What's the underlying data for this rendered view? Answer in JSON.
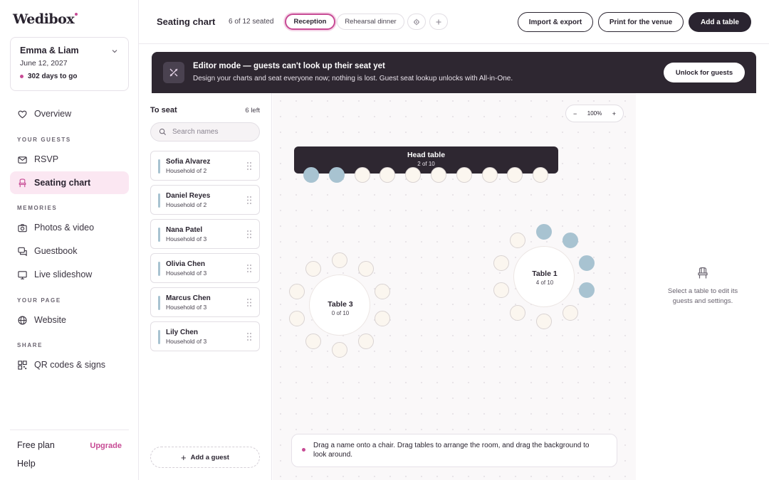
{
  "app": {
    "logo": "Wedibox"
  },
  "event": {
    "couple": "Emma & Liam",
    "date": "June 12, 2027",
    "countdown": "302 days to go"
  },
  "nav": {
    "overview": "Overview",
    "section_guests": "YOUR GUESTS",
    "rsvp": "RSVP",
    "seating_chart": "Seating chart",
    "section_memories": "MEMORIES",
    "photos_video": "Photos & video",
    "guestbook": "Guestbook",
    "live_slideshow": "Live slideshow",
    "section_page": "YOUR PAGE",
    "website": "Website",
    "section_share": "SHARE",
    "qr_codes": "QR codes & signs"
  },
  "footer": {
    "plan": "Free plan",
    "upgrade": "Upgrade",
    "help": "Help"
  },
  "topbar": {
    "title": "Seating chart",
    "seated": "6 of 12 seated",
    "tabs": [
      "Reception",
      "Rehearsal dinner"
    ],
    "active_tab": "Reception",
    "import_export": "Import & export",
    "print_venue": "Print for the venue",
    "add_table": "Add a table"
  },
  "banner": {
    "title": "Editor mode — guests can't look up their seat yet",
    "subtitle": "Design your charts and seat everyone now; nothing is lost. Guest seat lookup unlocks with All-in-One.",
    "unlock": "Unlock for guests"
  },
  "to_seat": {
    "title": "To seat",
    "left": "6 left",
    "search_placeholder": "Search names",
    "guests": [
      {
        "name": "Sofia Alvarez",
        "household": "Household of 2"
      },
      {
        "name": "Daniel Reyes",
        "household": "Household of 2"
      },
      {
        "name": "Nana Patel",
        "household": "Household of 3"
      },
      {
        "name": "Olivia Chen",
        "household": "Household of 3"
      },
      {
        "name": "Marcus Chen",
        "household": "Household of 3"
      },
      {
        "name": "Lily Chen",
        "household": "Household of 3"
      }
    ],
    "add_guest": "Add a guest"
  },
  "canvas": {
    "zoom": "100%",
    "zoom_out": "−",
    "zoom_in": "+",
    "tables": [
      {
        "name": "Head table",
        "count": "2 of 10",
        "seated": 2,
        "capacity": 10
      },
      {
        "name": "Table 1",
        "count": "4 of 10",
        "seated": 4,
        "capacity": 10
      },
      {
        "name": "Table 3",
        "count": "0 of 10",
        "seated": 0,
        "capacity": 10
      }
    ],
    "hint": "Drag a name onto a chair. Drag tables to arrange the room, and drag the background to look around."
  },
  "right_panel": {
    "message": "Select a table to edit its guests and settings."
  },
  "colors": {
    "accent": "#c74b95",
    "dark": "#2e2731",
    "seat_filled": "#a8c3d1",
    "seat_empty": "#fbf6ef"
  }
}
